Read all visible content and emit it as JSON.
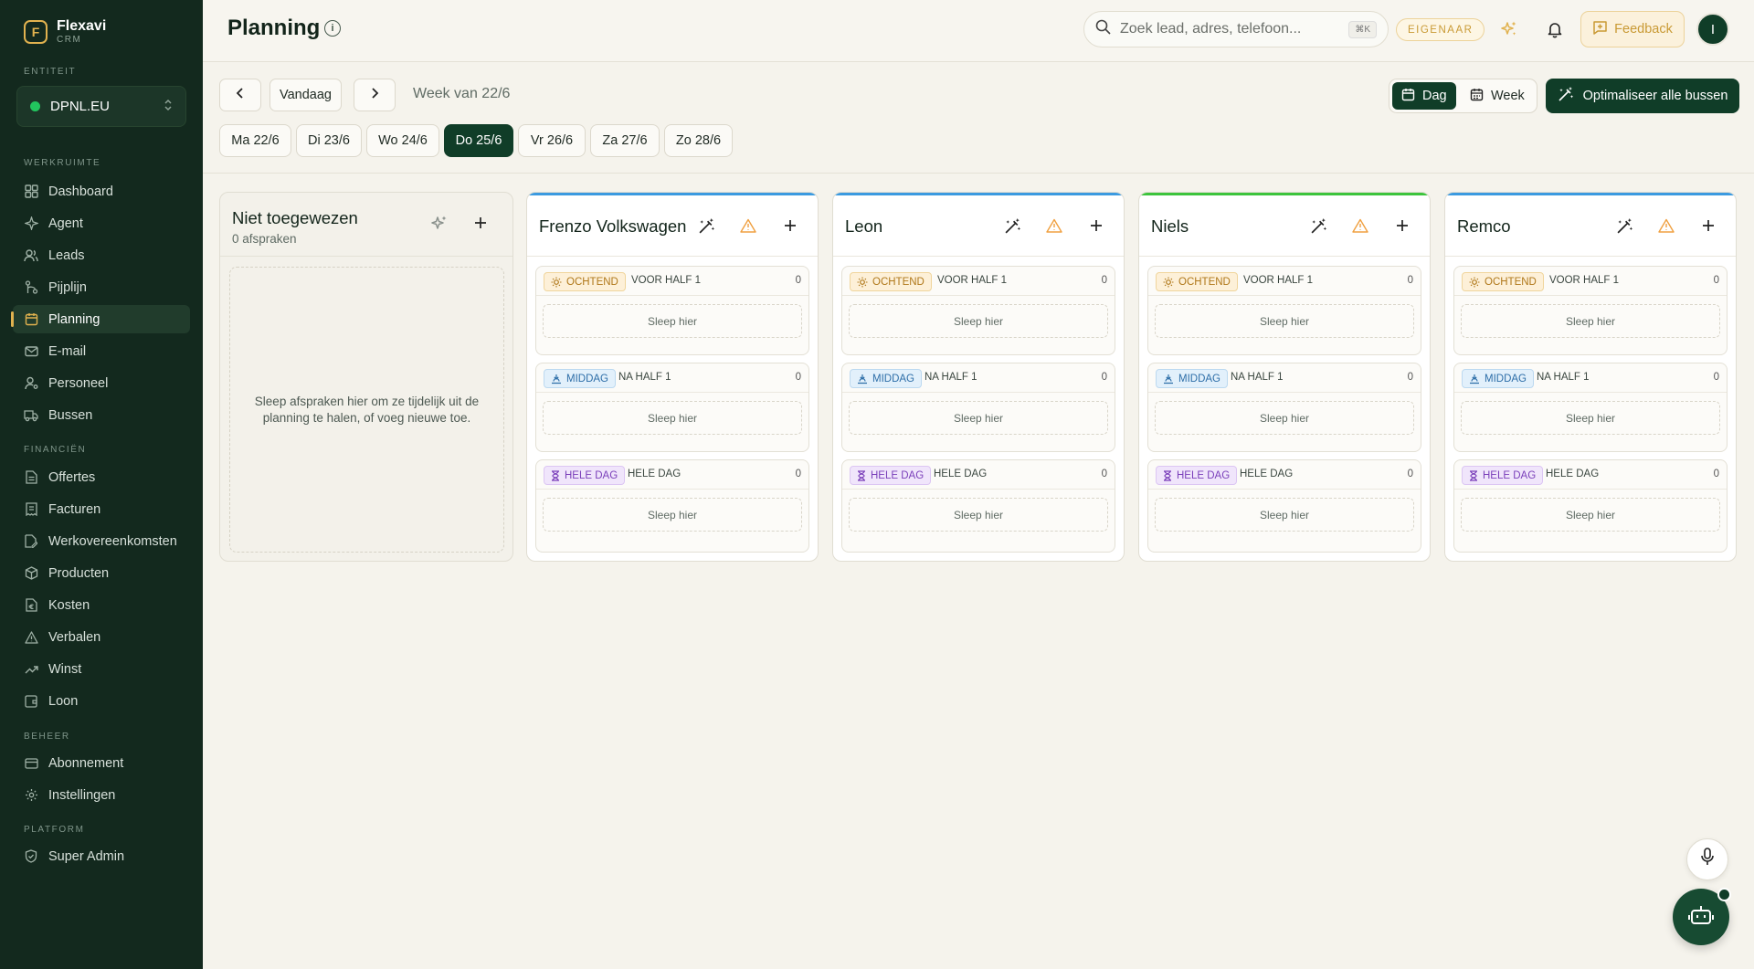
{
  "brand": {
    "name": "Flexavi",
    "sub": "CRM",
    "logo_letter": "F"
  },
  "sidebar": {
    "entity_label": "ENTITEIT",
    "entity_value": "DPNL.EU",
    "sections": {
      "werkruimte": "WERKRUIMTE",
      "financien": "FINANCIËN",
      "beheer": "BEHEER",
      "platform": "PLATFORM"
    },
    "items": {
      "dashboard": "Dashboard",
      "agent": "Agent",
      "leads": "Leads",
      "pijplijn": "Pijplijn",
      "planning": "Planning",
      "email": "E-mail",
      "personeel": "Personeel",
      "bussen": "Bussen",
      "offertes": "Offertes",
      "facturen": "Facturen",
      "werkovereenkomsten": "Werkovereenkomsten",
      "producten": "Producten",
      "kosten": "Kosten",
      "verbalen": "Verbalen",
      "winst": "Winst",
      "loon": "Loon",
      "abonnement": "Abonnement",
      "instellingen": "Instellingen",
      "super_admin": "Super Admin"
    }
  },
  "header": {
    "title": "Planning",
    "search_placeholder": "Zoek lead, adres, telefoon...",
    "search_shortcut": "⌘K",
    "role_badge": "EIGENAAR",
    "feedback_label": "Feedback",
    "avatar_initial": "I"
  },
  "toolbar": {
    "today_label": "Vandaag",
    "week_label": "Week van 22/6",
    "view_day": "Dag",
    "view_week": "Week",
    "optimize_label": "Optimaliseer alle bussen",
    "days": [
      "Ma 22/6",
      "Di 23/6",
      "Wo 24/6",
      "Do 25/6",
      "Vr 26/6",
      "Za 27/6",
      "Zo 28/6"
    ],
    "active_day": "Do 25/6"
  },
  "unassigned": {
    "title": "Niet toegewezen",
    "subtitle": "0 afspraken",
    "hint": "Sleep afspraken hier om ze tijdelijk uit de planning te halen, of voeg nieuwe toe."
  },
  "slots": {
    "ochtend": {
      "badge": "OCHTEND",
      "label": "VOOR HALF 1"
    },
    "middag": {
      "badge": "MIDDAG",
      "label": "NA HALF 1"
    },
    "heledag": {
      "badge": "HELE DAG",
      "label": "HELE DAG"
    },
    "drop_text": "Sleep hier",
    "count": "0"
  },
  "buses": [
    {
      "name": "Frenzo Volkswagen",
      "color": "#3b9ae0"
    },
    {
      "name": "Leon",
      "color": "#3b9ae0"
    },
    {
      "name": "Niels",
      "color": "#3cc43c"
    },
    {
      "name": "Remco",
      "color": "#3b9ae0"
    }
  ],
  "colors": {
    "sidebar_bg": "#13291e",
    "accent_gold": "#e1b24f",
    "primary_green": "#103d28",
    "warning_orange": "#f0a040"
  }
}
